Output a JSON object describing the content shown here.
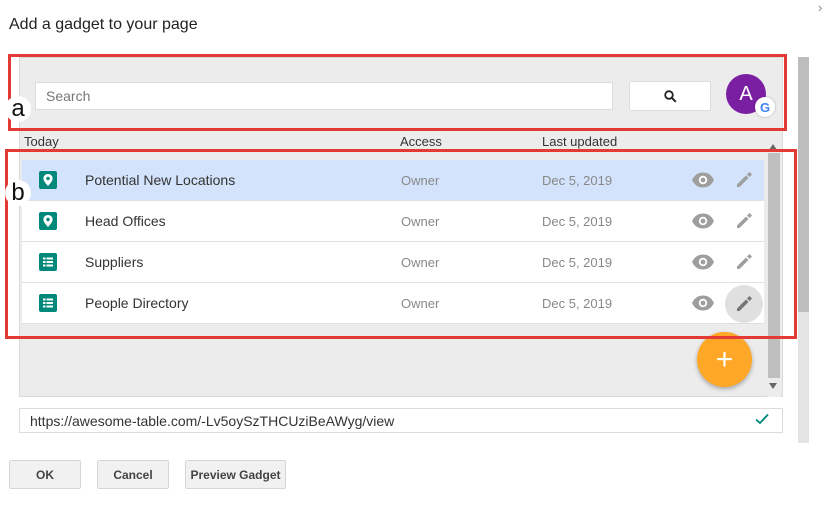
{
  "dialog": {
    "title": "Add a gadget to your page"
  },
  "search": {
    "placeholder": "Search",
    "value": "",
    "avatar_initial": "A",
    "badge_letter": "G"
  },
  "table": {
    "columns": {
      "name": "Today",
      "access": "Access",
      "updated": "Last updated"
    },
    "rows": [
      {
        "name": "Potential New Locations",
        "access": "Owner",
        "updated": "Dec 5, 2019",
        "icon": "map-pin-icon",
        "selected": true
      },
      {
        "name": "Head Offices",
        "access": "Owner",
        "updated": "Dec 5, 2019",
        "icon": "map-pin-icon",
        "selected": false
      },
      {
        "name": "Suppliers",
        "access": "Owner",
        "updated": "Dec 5, 2019",
        "icon": "sheet-icon",
        "selected": false
      },
      {
        "name": "People Directory",
        "access": "Owner",
        "updated": "Dec 5, 2019",
        "icon": "sheet-icon",
        "selected": false
      }
    ]
  },
  "fab": {
    "label": "+"
  },
  "annotations": {
    "a": "a",
    "b": "b"
  },
  "url": {
    "value": "https://awesome-table.com/-Lv5oySzTHCUziBeAWyg/view"
  },
  "buttons": {
    "ok": "OK",
    "cancel": "Cancel",
    "preview": "Preview Gadget"
  },
  "colors": {
    "selected_row": "#d3e3fb",
    "icon_green": "#00897b",
    "fab": "#ffa726",
    "avatar": "#7b1fa2",
    "annotation": "#e53935"
  }
}
